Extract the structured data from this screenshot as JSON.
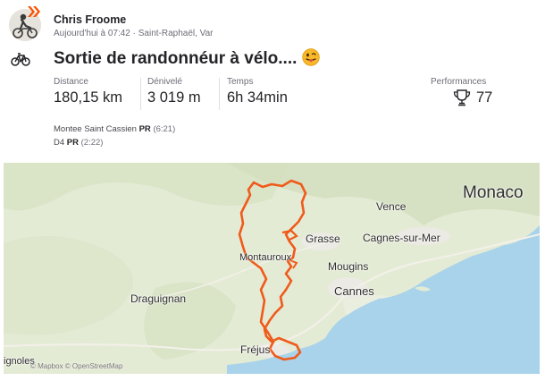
{
  "activity": {
    "athlete_name": "Chris Froome",
    "datetime_location": "Aujourd'hui à 07:42 · Saint-Raphaël, Var",
    "sport_icon": "bike-icon",
    "title": "Sortie de randonnéur à vélo....",
    "title_emoji": "tongue-out-emoji"
  },
  "stats": {
    "distance_label": "Distance",
    "distance_value": "180,15 km",
    "elevation_label": "Dénivelé",
    "elevation_value": "3 019 m",
    "time_label": "Temps",
    "time_value": "6h 34min",
    "performances_label": "Performances",
    "performances_value": "77",
    "performances_icon": "trophy-icon"
  },
  "segments": [
    {
      "name": "Montee Saint Cassien",
      "badge": "PR",
      "time": "(6:21)"
    },
    {
      "name": "D4",
      "badge": "PR",
      "time": "(2:22)"
    }
  ],
  "map": {
    "places": {
      "monaco": "Monaco",
      "vence": "Vence",
      "grasse": "Grasse",
      "cagnes": "Cagnes-sur-Mer",
      "montauroux": "Montauroux",
      "mougins": "Mougins",
      "cannes": "Cannes",
      "draguignan": "Draguignan",
      "frejus": "Fréjus",
      "lignoles": "ignoles"
    },
    "route_color": "#f05a1a",
    "sea_color": "#a9d3ea",
    "attribution": "© Mapbox © OpenStreetMap"
  },
  "colors": {
    "brand": "#fc5200",
    "text": "#242428",
    "muted": "#6d6d78"
  }
}
